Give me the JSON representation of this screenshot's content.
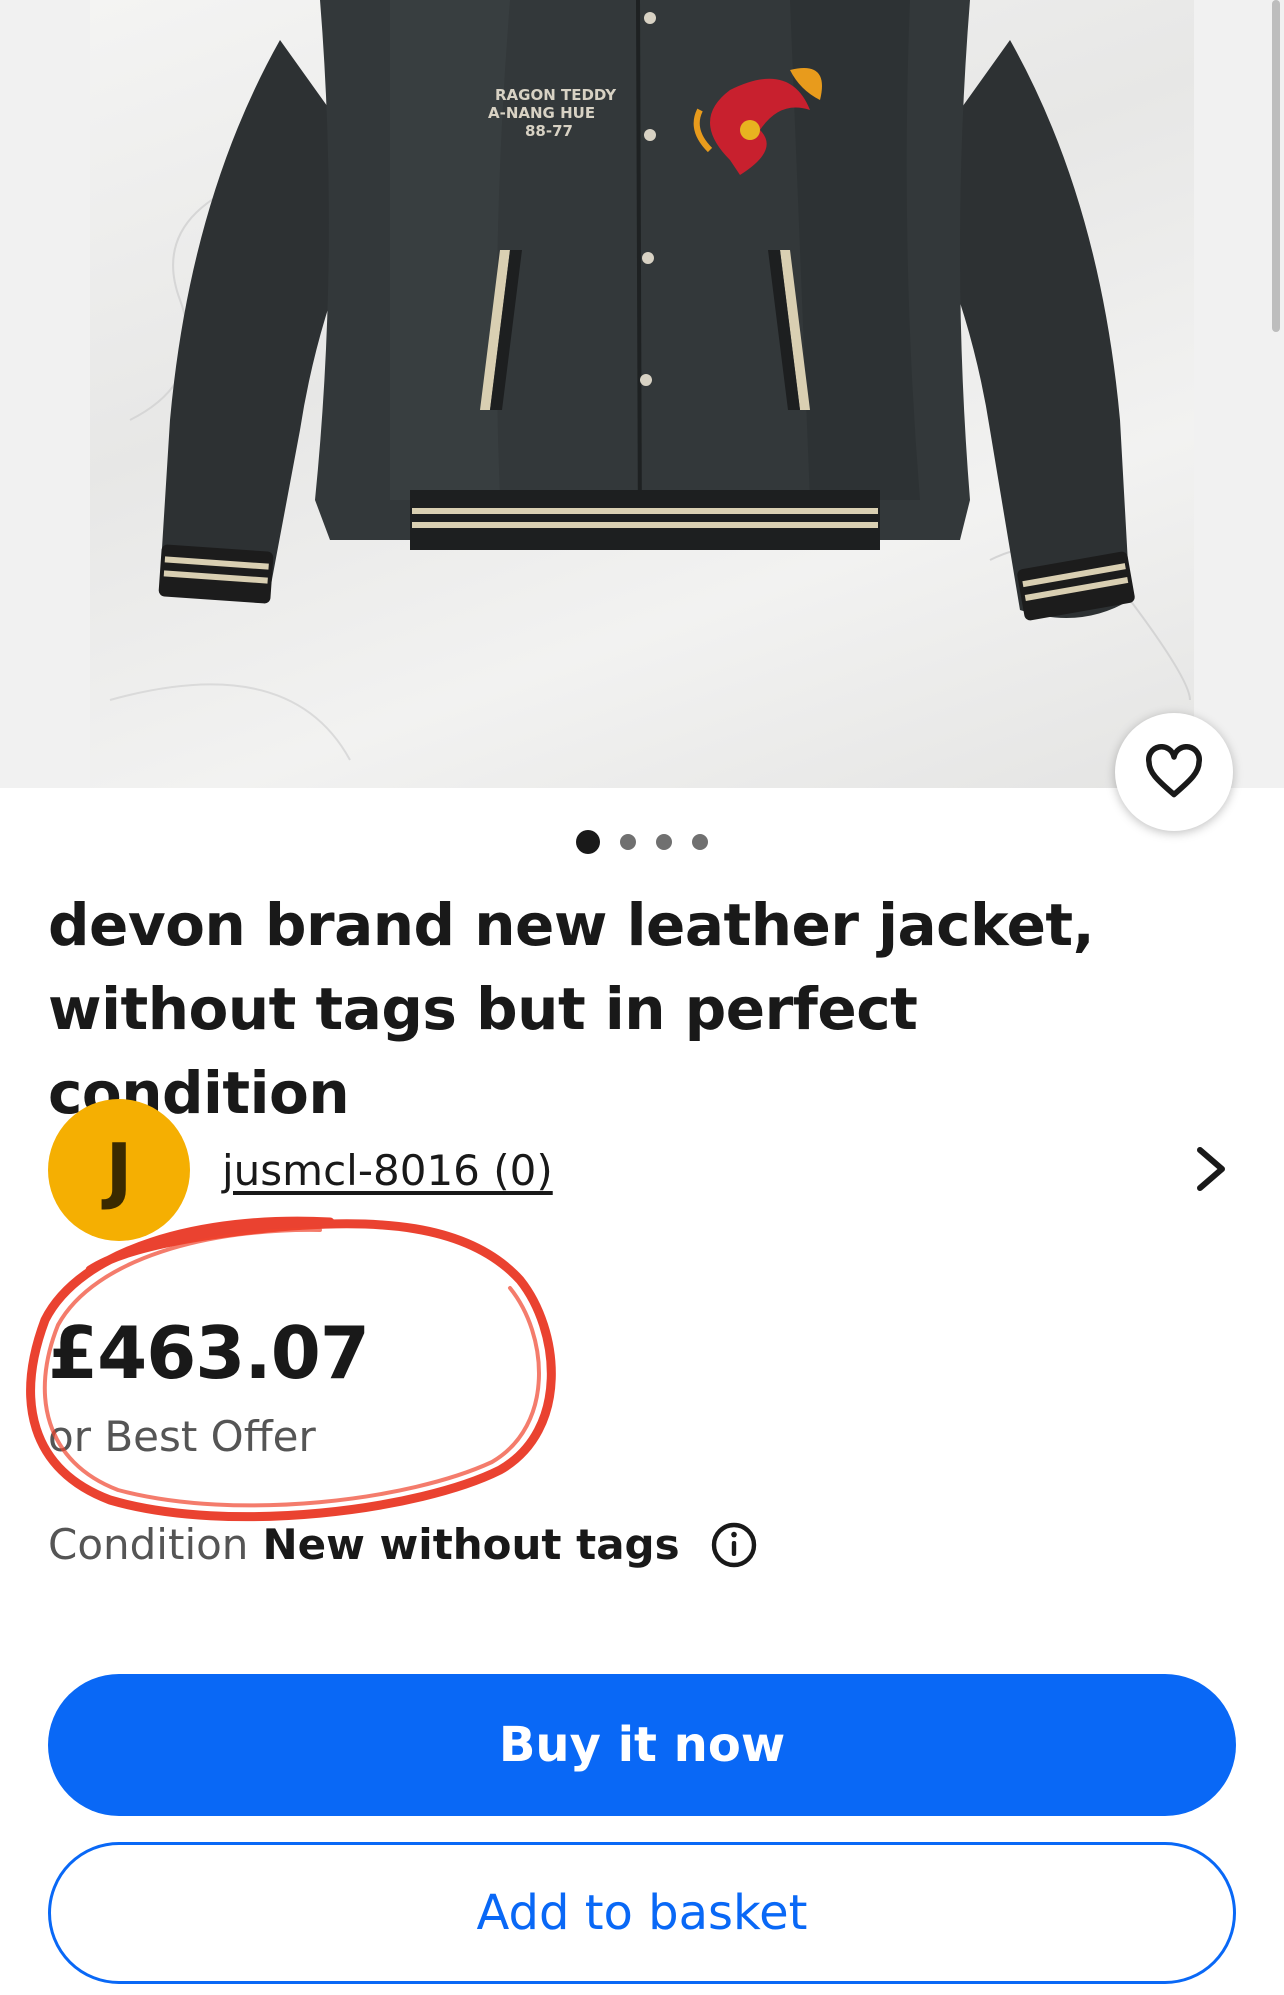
{
  "gallery": {
    "image_alt": "",
    "jacket_text_lines": [
      "RAGON TEDDY",
      "A-NANG HUE",
      "88-77"
    ],
    "dots_count": 4,
    "active_dot": 0,
    "favorite_icon": "heart-icon"
  },
  "listing": {
    "title": "devon brand new leather jacket, without tags but in perfect condition"
  },
  "seller": {
    "avatar_letter": "J",
    "name": "jusmcl-8016 (0)",
    "chevron_icon": "chevron-right-icon"
  },
  "price": {
    "amount": "£463.07",
    "best_offer": "or Best Offer"
  },
  "condition": {
    "label": "Condition",
    "value": "New without tags",
    "info_icon": "info-icon"
  },
  "actions": {
    "buy_now": "Buy it now",
    "add_to_basket": "Add to basket"
  },
  "colors": {
    "primary_blue": "#0968f6",
    "avatar_yellow": "#f5af02",
    "annotation_red": "#e8321e"
  }
}
